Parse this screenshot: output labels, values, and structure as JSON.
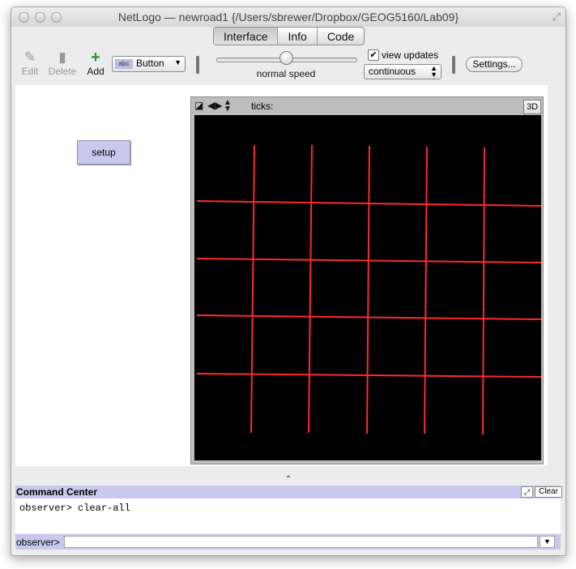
{
  "window": {
    "title": "NetLogo — newroad1 {/Users/sbrewer/Dropbox/GEOG5160/Lab09}",
    "tabs": [
      {
        "label": "Interface",
        "active": true
      },
      {
        "label": "Info",
        "active": false
      },
      {
        "label": "Code",
        "active": false
      }
    ]
  },
  "toolbar": {
    "edit_label": "Edit",
    "delete_label": "Delete",
    "add_label": "Add",
    "widget_type_icon": "abc",
    "widget_type": "Button",
    "speed_label": "normal speed",
    "speed_value": 0.5,
    "view_updates_label": "view updates",
    "view_updates_checked": true,
    "update_mode": "continuous",
    "settings_label": "Settings..."
  },
  "interface": {
    "setup_button_label": "setup",
    "view": {
      "ticks_label": "ticks:",
      "ticks_value": "",
      "three_d_label": "3D",
      "background_color": "#000000",
      "road_color": "#ff2a2a"
    }
  },
  "command_center": {
    "title": "Command Center",
    "clear_label": "Clear",
    "output_lines": [
      "observer> clear-all"
    ],
    "prompt_label": "observer>",
    "input_value": ""
  },
  "colors": {
    "accent": "#c8c9ec",
    "window_bg": "#ececec"
  }
}
